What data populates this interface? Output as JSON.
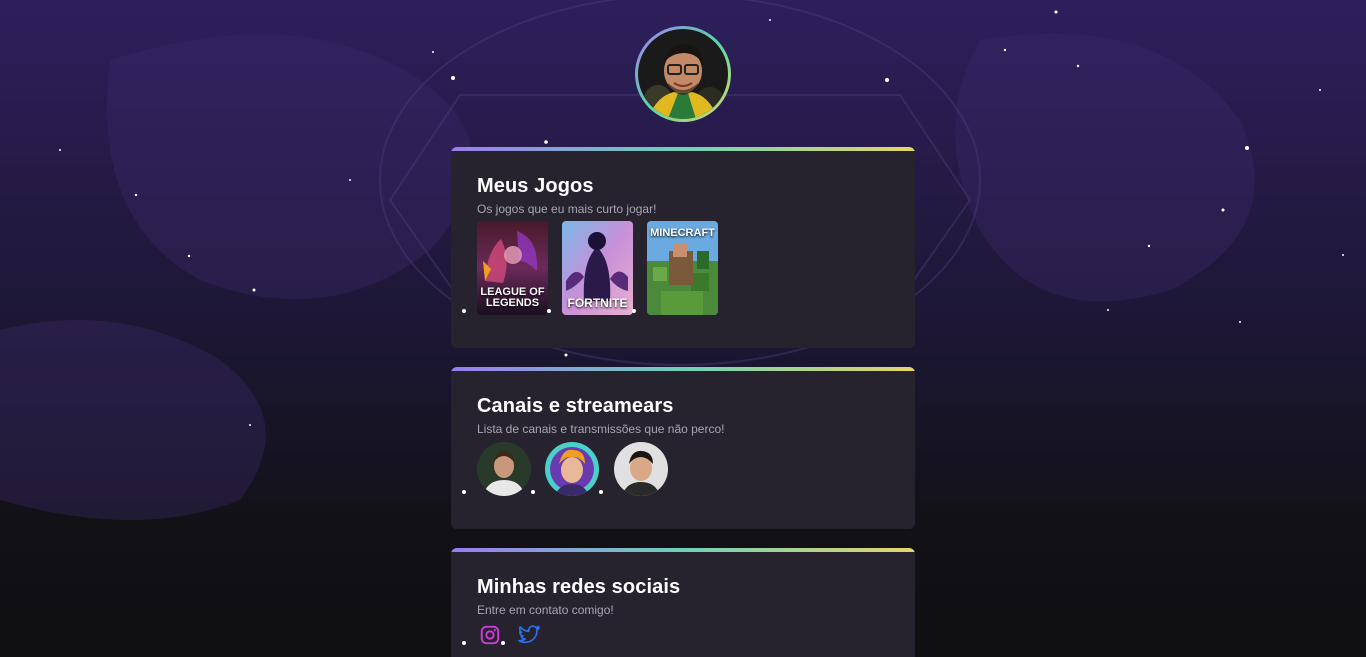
{
  "profile": {
    "avatar_icon": "profile-photo"
  },
  "games_section": {
    "title": "Meus Jogos",
    "subtitle": "Os jogos que eu mais curto jogar!",
    "games": [
      {
        "name": "LEAGUE OF LEGENDS",
        "icon": "league-of-legends-cover"
      },
      {
        "name": "FORTNITE",
        "icon": "fortnite-cover"
      },
      {
        "name": "MINECRAFT",
        "icon": "minecraft-cover"
      }
    ]
  },
  "channels_section": {
    "title": "Canais e streamears",
    "subtitle": "Lista de canais e transmissões que não perco!",
    "channels": [
      {
        "icon": "streamer-avatar-1"
      },
      {
        "icon": "streamer-avatar-2"
      },
      {
        "icon": "streamer-avatar-3"
      }
    ]
  },
  "social_section": {
    "title": "Minhas redes sociais",
    "subtitle": "Entre em contato comigo!",
    "links": [
      {
        "icon": "instagram-icon",
        "color": "#d63ce0"
      },
      {
        "icon": "twitter-icon",
        "color": "#2f6fe6"
      }
    ]
  },
  "colors": {
    "accent_gradient": [
      "#9b7bf0",
      "#6fd1b8",
      "#e6d56a"
    ],
    "card_bg": "#26232f"
  }
}
